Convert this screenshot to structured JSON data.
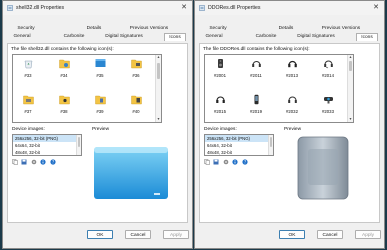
{
  "left": {
    "title": "shell32.dll Properties",
    "tabs_row1": [
      "Security",
      "Details",
      "Previous Versions"
    ],
    "tabs_row2": [
      "General",
      "Carbonite",
      "Digital Signatures",
      "Icons"
    ],
    "caption": "The file shell32.dll contains the following icon(s):",
    "icons": [
      "#33",
      "#34",
      "#35",
      "#36",
      "#37",
      "#38",
      "#39",
      "#40"
    ],
    "device_images_label": "Device images:",
    "preview_label": "Preview",
    "device_images": [
      "256x256, 32-bit (PNG)",
      "64x64, 32-bit",
      "48x48, 32-bit"
    ],
    "buttons": {
      "ok": "OK",
      "cancel": "Cancel",
      "apply": "Apply"
    }
  },
  "right": {
    "title": "DDORes.dll Properties",
    "tabs_row1": [
      "Security",
      "Details",
      "Previous Versions"
    ],
    "tabs_row2": [
      "General",
      "Carbonite",
      "Digital Signatures",
      "Icons"
    ],
    "caption": "The file DDORes.dll contains the following icon(s):",
    "icons": [
      "#2001",
      "#2011",
      "#2013",
      "#2014",
      "#2015",
      "#2019",
      "#2032",
      "#2033"
    ],
    "device_images_label": "Device images:",
    "preview_label": "Preview",
    "device_images": [
      "256x256, 32-bit (PNG)",
      "64x64, 32-bit",
      "48x48, 32-bit"
    ],
    "buttons": {
      "ok": "OK",
      "cancel": "Cancel",
      "apply": "Apply"
    }
  },
  "colors": {
    "desktop": "#1b3a4a",
    "selection": "#cce4f7",
    "ok_border": "#3c7fb1"
  }
}
